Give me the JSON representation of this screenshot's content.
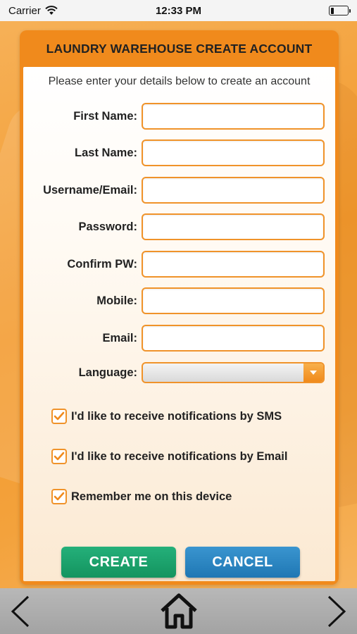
{
  "status_bar": {
    "carrier": "Carrier",
    "time": "12:33 PM",
    "battery_level": 0.2
  },
  "header": {
    "title": "LAUNDRY WAREHOUSE CREATE ACCOUNT"
  },
  "form": {
    "intro": "Please enter your details below to create an account",
    "fields": [
      {
        "label": "First Name:",
        "value": ""
      },
      {
        "label": "Last Name:",
        "value": ""
      },
      {
        "label": "Username/Email:",
        "value": ""
      },
      {
        "label": "Password:",
        "value": ""
      },
      {
        "label": "Confirm PW:",
        "value": ""
      },
      {
        "label": "Mobile:",
        "value": ""
      },
      {
        "label": "Email:",
        "value": ""
      }
    ],
    "language": {
      "label": "Language:",
      "selected": ""
    },
    "options": [
      {
        "label": "I'd like to receive notifications by SMS",
        "checked": true
      },
      {
        "label": "I'd like to receive notifications by Email",
        "checked": true
      },
      {
        "label": "Remember me on this device",
        "checked": true
      }
    ]
  },
  "buttons": {
    "create": "CREATE",
    "cancel": "CANCEL"
  },
  "nav": {
    "back_icon": "chevron-left-icon",
    "home_icon": "home-icon",
    "forward_icon": "chevron-right-icon"
  },
  "colors": {
    "accent": "#f08a1c",
    "create": "#1aa06b",
    "cancel": "#2b86c3"
  }
}
